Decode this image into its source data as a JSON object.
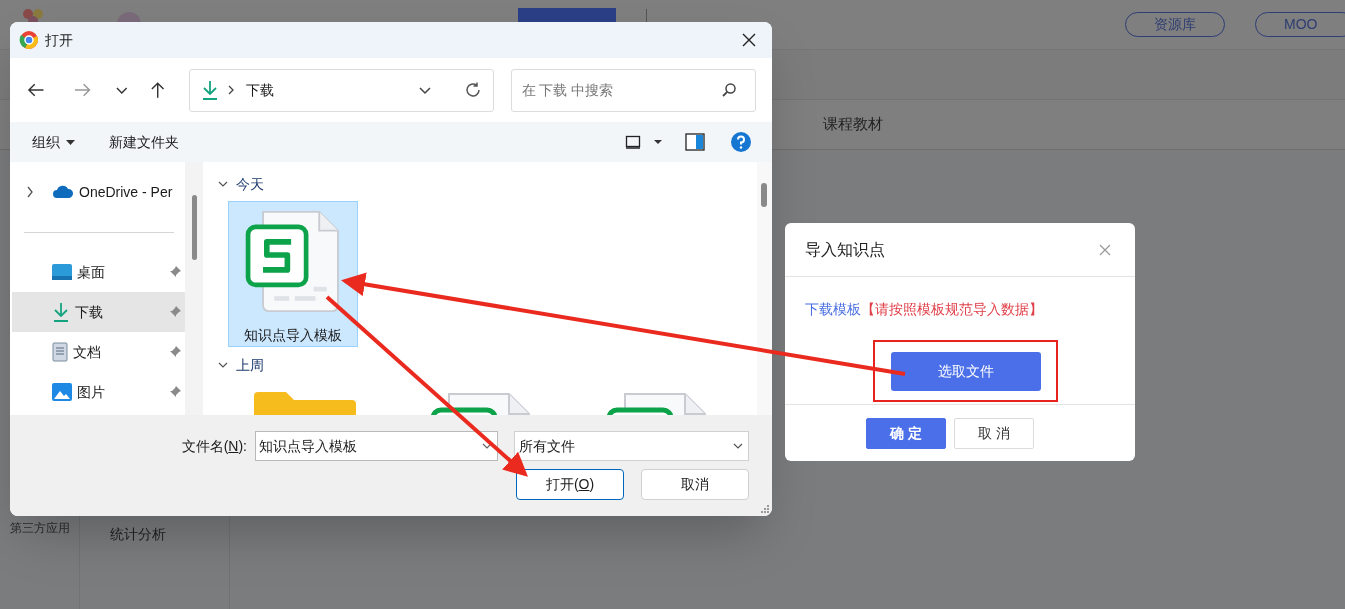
{
  "page": {
    "header_buttons": [
      "资源库",
      "MOO"
    ],
    "tabs": [
      "课程教材"
    ],
    "sidebar": [
      "第三方应用"
    ],
    "subnav": [
      "统计分析"
    ]
  },
  "file_dialog": {
    "title": "打开",
    "address": "下载",
    "search": {
      "placeholder": "在 下载 中搜索"
    },
    "commands": [
      "组织",
      "新建文件夹"
    ],
    "nav_items": [
      {
        "label": "OneDrive - Per",
        "kind": "cloud",
        "selected": false,
        "pinned": false
      },
      {
        "label": "桌面",
        "kind": "desktop",
        "selected": false,
        "pinned": true
      },
      {
        "label": "下载",
        "kind": "download",
        "selected": true,
        "pinned": true
      },
      {
        "label": "文档",
        "kind": "document",
        "selected": false,
        "pinned": true
      },
      {
        "label": "图片",
        "kind": "image",
        "selected": false,
        "pinned": true
      }
    ],
    "groups": [
      {
        "label": "今天",
        "items": [
          {
            "name": "知识点导入模板",
            "kind": "spreadsheet",
            "selected": true
          }
        ]
      },
      {
        "label": "上周",
        "items": [
          {
            "kind": "folder",
            "selected": false
          },
          {
            "kind": "spreadsheet",
            "selected": false
          },
          {
            "kind": "spreadsheet",
            "selected": false
          }
        ]
      }
    ],
    "filename_label": {
      "before": "文件名(",
      "key": "N",
      "after": "):"
    },
    "filename": "知识点导入模板",
    "filetype": "所有文件",
    "open_button": {
      "before": "打开(",
      "key": "O",
      "after": ")"
    },
    "cancel_button": "取消"
  },
  "import_dialog": {
    "title": "导入知识点",
    "template_link": "下载模板",
    "note": "【请按照模板规范导入数据】",
    "choose_button": "选取文件",
    "buttons": [
      {
        "label": "确 定",
        "kind": "primary"
      },
      {
        "label": "取 消",
        "kind": "default"
      }
    ]
  }
}
